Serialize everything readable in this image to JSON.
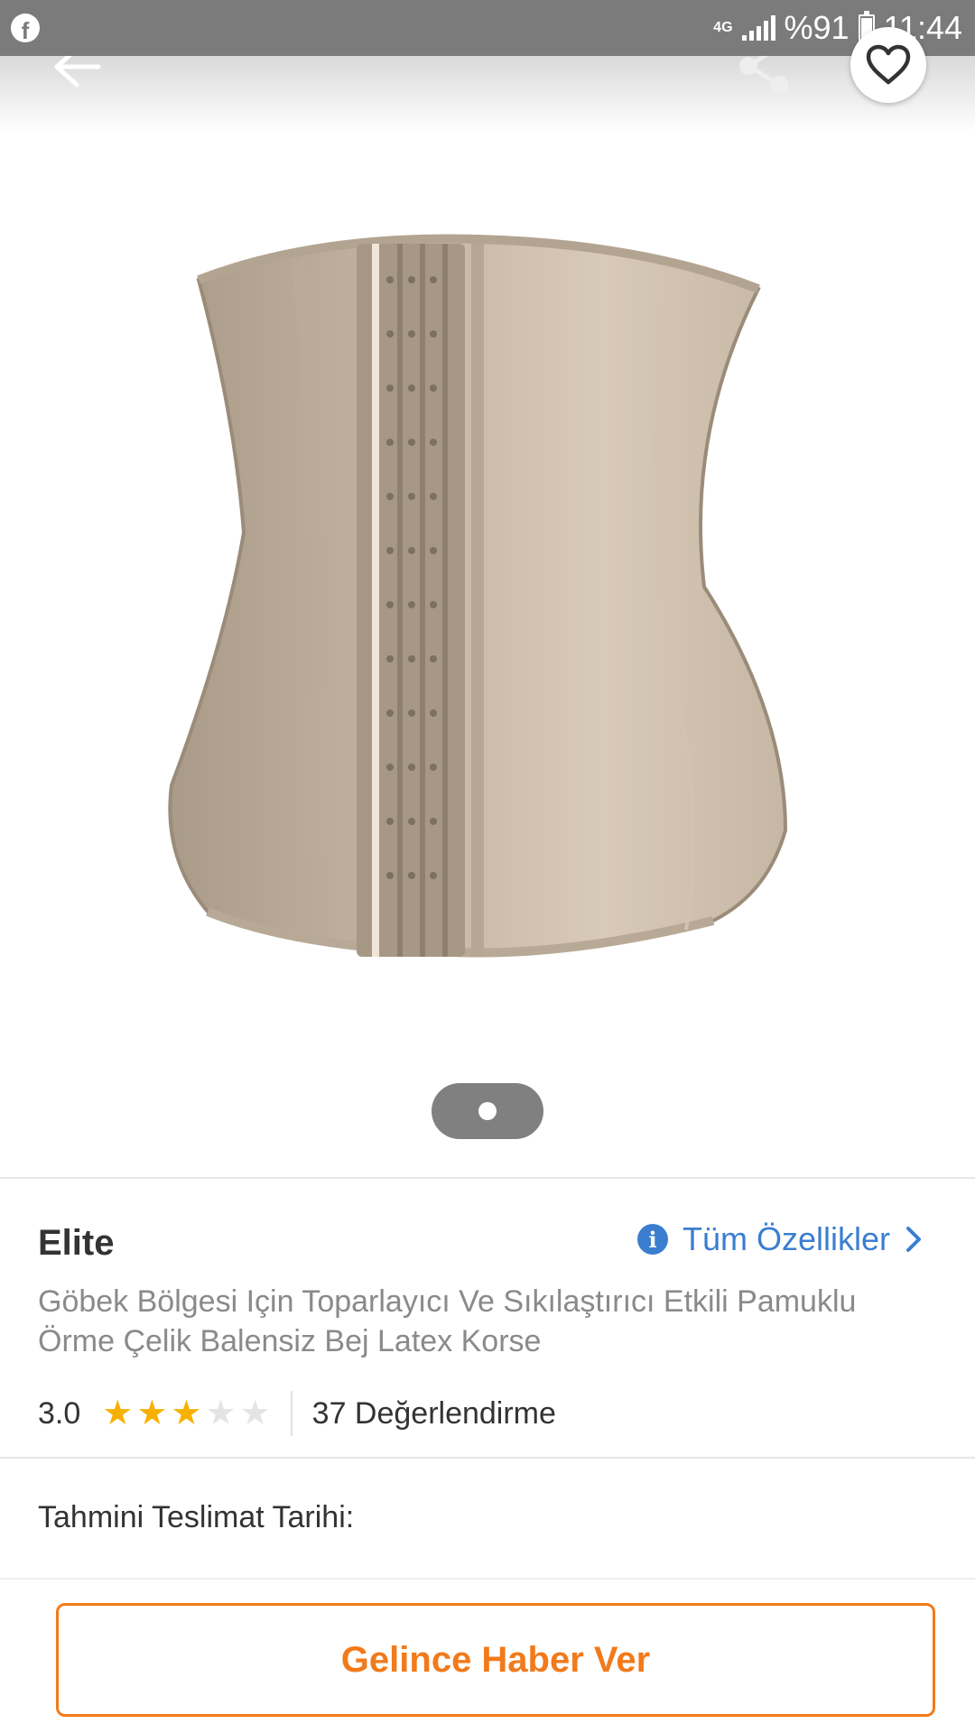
{
  "status_bar": {
    "network": "4G",
    "battery": "%91",
    "time": "11:44"
  },
  "icons": {
    "app_notification": "facebook-icon",
    "back": "arrow-left-icon",
    "share": "share-icon",
    "favorite": "heart-outline-icon",
    "info": "info-icon",
    "chevron": "chevron-right-icon"
  },
  "gallery": {
    "current_page": 1,
    "total_pages": 1
  },
  "product": {
    "brand": "Elite",
    "all_specs_label": "Tüm Özellikler",
    "title": "Göbek Bölgesi Için Toparlayıcı Ve Sıkılaştırıcı Etkili Pamuklu Örme Çelik Balensiz Bej Latex Korse",
    "rating": "3.0",
    "rating_value": 3,
    "rating_max": 5,
    "review_count": "37 Değerlendirme"
  },
  "delivery": {
    "label": "Tahmini Teslimat Tarihi:"
  },
  "actions": {
    "notify_label": "Gelince Haber Ver"
  },
  "colors": {
    "accent": "#f27a1a",
    "link": "#3b7ed0",
    "star": "#f6b100"
  }
}
